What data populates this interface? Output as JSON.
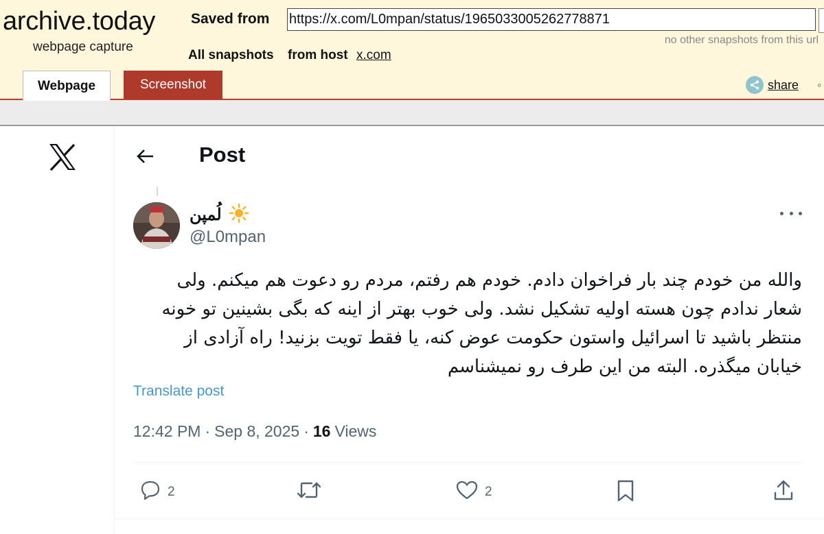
{
  "archive": {
    "logo": "archive.today",
    "tagline": "webpage capture",
    "saved_from_label": "Saved from",
    "url_value": "https://x.com/L0mpan/status/1965033005262778871",
    "no_snapshots_text": "no other snapshots from this url",
    "all_snapshots_label": "All snapshots",
    "from_host_label": "from host",
    "host_link": "x.com",
    "tabs": [
      {
        "label": "Webpage",
        "active": true
      },
      {
        "label": "Screenshot",
        "active": false
      }
    ],
    "share_label": "share",
    "colors": {
      "header_bg": "#fff7dc",
      "screenshot_tab": "#ad3a2a",
      "divider": "#c0392b"
    }
  },
  "post": {
    "heading": "Post",
    "author": {
      "display_name": "لُمپن",
      "emoji_icon": "sun-emoji",
      "handle": "@L0mpan"
    },
    "text": "والله من خودم چند بار فراخوان دادم. خودم هم رفتم، مردم رو دعوت هم میکنم. ولی شعار ندادم چون هسته اولیه تشکیل نشد. ولی خوب بهتر از اینه که بگی بشینین تو خونه منتظر باشید تا اسرائیل واستون حکومت عوض کنه، یا فقط تویت بزنید! راه آزادی از خیابان میگذره. البته من این طرف رو نمیشناسم",
    "translate_label": "Translate post",
    "time": "12:42 PM",
    "separator": "·",
    "date": "Sep 8, 2025",
    "views_count": "16",
    "views_label": "Views",
    "actions": {
      "reply_count": "2",
      "like_count": "2"
    },
    "colors": {
      "link": "#4a97c9",
      "muted": "#536471",
      "text": "#0f1419"
    }
  }
}
